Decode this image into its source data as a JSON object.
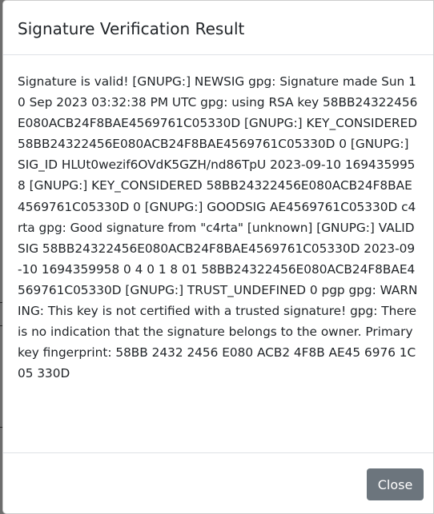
{
  "dialog": {
    "title": "Signature Verification Result",
    "body_text": "Signature is valid! [GNUPG:] NEWSIG gpg: Signature made Sun 10 Sep 2023 03:32:38 PM UTC gpg: using RSA key 58BB24322456E080ACB24F8BAE4569761C05330D [GNUPG:] KEY_CONSIDERED 58BB24322456E080ACB24F8BAE4569761C05330D 0 [GNUPG:] SIG_ID HLUt0wezif6OVdK5GZH/nd86TpU 2023-09-10 1694359958 [GNUPG:] KEY_CONSIDERED 58BB24322456E080ACB24F8BAE4569761C05330D 0 [GNUPG:] GOODSIG AE4569761C05330D c4rta gpg: Good signature from \"c4rta\" [unknown] [GNUPG:] VALIDSIG 58BB24322456E080ACB24F8BAE4569761C05330D 2023-09-10 1694359958 0 4 0 1 8 01 58BB24322456E080ACB24F8BAE4569761C05330D [GNUPG:] TRUST_UNDEFINED 0 pgp gpg: WARNING: This key is not certified with a trusted signature! gpg: There is no indication that the signature belongs to the owner. Primary key fingerprint: 58BB 2432 2456 E080 ACB2 4F8B AE45 6976 1C05 330D",
    "close_label": "Close"
  },
  "colors": {
    "overlay": "#6d6d6d",
    "dialog_background": "#ffffff",
    "text": "#212529",
    "divider": "#dee2e6",
    "close_button": "#6c757d"
  }
}
